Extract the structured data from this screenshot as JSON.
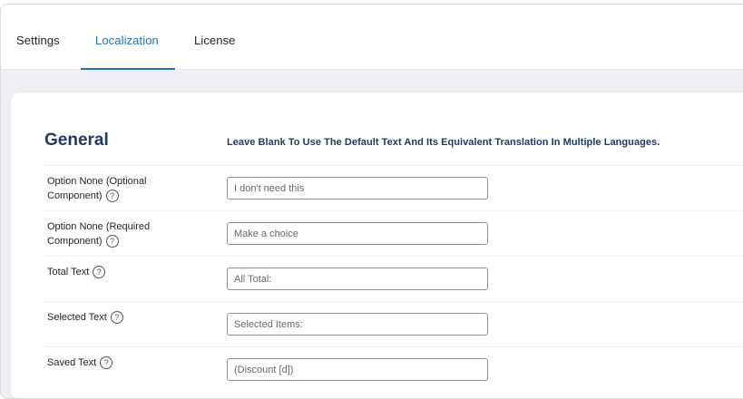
{
  "tabs": [
    {
      "label": "Settings",
      "active": false
    },
    {
      "label": "Localization",
      "active": true
    },
    {
      "label": "License",
      "active": false
    }
  ],
  "accent_color": "#2271b1",
  "heading_color": "#1e3a5f",
  "section": {
    "title": "General",
    "hint": "Leave Blank To Use The Default Text And Its Equivalent Translation In Multiple Languages."
  },
  "fields": [
    {
      "label_line1": "Option None (Optional",
      "label_line2": "Component)",
      "placeholder": "I don't need this",
      "value": "",
      "help_icon": "question-circle-icon"
    },
    {
      "label_line1": "Option None (Required",
      "label_line2": "Component)",
      "placeholder": "Make a choice",
      "value": "",
      "help_icon": "question-circle-icon"
    },
    {
      "label_line1": "Total Text",
      "label_line2": "",
      "placeholder": "All Total:",
      "value": "",
      "help_icon": "question-circle-icon"
    },
    {
      "label_line1": "Selected Text",
      "label_line2": "",
      "placeholder": "Selected Items:",
      "value": "",
      "help_icon": "question-circle-icon"
    },
    {
      "label_line1": "Saved Text",
      "label_line2": "",
      "placeholder": "(Discount [d])",
      "value": "",
      "help_icon": "question-circle-icon"
    }
  ]
}
